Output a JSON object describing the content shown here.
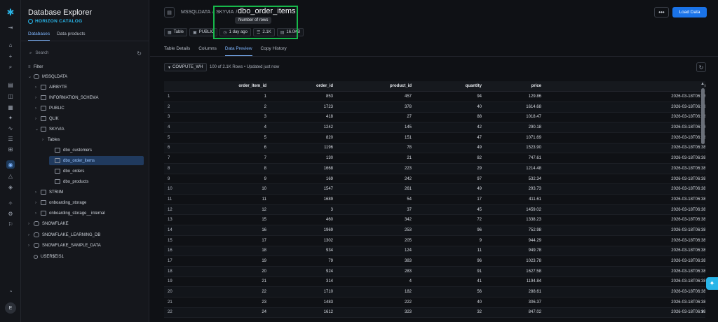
{
  "rail": {
    "icons": [
      "collapse-icon",
      "home-icon",
      "plus-icon",
      "search-icon",
      "worksheet-icon",
      "projects-icon",
      "dashboards-icon",
      "ai-ml-icon",
      "monitoring-icon",
      "marketplace-icon",
      "apps-icon",
      "data-icon",
      "governance-icon",
      "admin-icon",
      "settings-icon",
      "help-icon",
      "bell-icon"
    ],
    "avatar_initial": "E"
  },
  "explorer": {
    "title": "Database Explorer",
    "subtitle": "HORIZON CATALOG",
    "tabs": [
      "Databases",
      "Data products"
    ],
    "active_tab": "Databases",
    "search_placeholder": "Search",
    "tree": [
      {
        "label": "Filter",
        "kind": "filter"
      },
      {
        "label": "MSSQLDATA",
        "kind": "db",
        "open": true
      },
      {
        "label": "AIRBYTE",
        "kind": "schema"
      },
      {
        "label": "INFORMATION_SCHEMA",
        "kind": "schema"
      },
      {
        "label": "PUBLIC",
        "kind": "schema"
      },
      {
        "label": "QLIK",
        "kind": "schema"
      },
      {
        "label": "SKYVIA",
        "kind": "schema",
        "open": true
      },
      {
        "label": "Tables",
        "kind": "folder"
      },
      {
        "label": "dbo_customers",
        "kind": "table"
      },
      {
        "label": "dbo_order_items",
        "kind": "table",
        "selected": true
      },
      {
        "label": "dbo_orders",
        "kind": "table"
      },
      {
        "label": "dbo_products",
        "kind": "table"
      },
      {
        "label": "STRIIM",
        "kind": "schema"
      },
      {
        "label": "onboarding_storage",
        "kind": "schema"
      },
      {
        "label": "onboarding_storage__internal",
        "kind": "schema"
      },
      {
        "label": "SNOWFLAKE",
        "kind": "db"
      },
      {
        "label": "SNOWFLAKE_LEARNING_DB",
        "kind": "db"
      },
      {
        "label": "SNOWFLAKE_SAMPLE_DATA",
        "kind": "db"
      },
      {
        "label": "USER$EIS1",
        "kind": "user"
      }
    ]
  },
  "header": {
    "breadcrumb": [
      "MSSQLDATA",
      "/",
      "SKYVIA",
      "/"
    ],
    "object_name": "dbo_order_items",
    "tooltip": "Number of rows",
    "chips": [
      {
        "icon": "table-icon",
        "label": "Table"
      },
      {
        "icon": "schema-icon",
        "label": "PUBLIC"
      },
      {
        "icon": "clock-icon",
        "label": "1 day ago"
      },
      {
        "icon": "rows-icon",
        "label": "2.1K"
      },
      {
        "icon": "size-icon",
        "label": "16.0KB"
      }
    ],
    "more_label": "•••",
    "load_label": "Load Data"
  },
  "tabs": [
    "Table Details",
    "Columns",
    "Data Preview",
    "Copy History"
  ],
  "active_tab": "Data Preview",
  "warehouse": "COMPUTE_WH",
  "rows_info": "100 of 2.1K Rows • Updated just now",
  "table": {
    "columns": [
      "",
      "order_item_id",
      "order_id",
      "product_id",
      "quantity",
      "price",
      "modified"
    ],
    "rows": [
      [
        "1",
        "1",
        "853",
        "457",
        "94",
        "129.86",
        "2026-03-18T06:38:21.8033"
      ],
      [
        "2",
        "2",
        "1723",
        "378",
        "40",
        "1614.68",
        "2026-03-18T06:38:21.8033"
      ],
      [
        "3",
        "3",
        "418",
        "27",
        "88",
        "1018.47",
        "2026-03-18T06:38:21.8033"
      ],
      [
        "4",
        "4",
        "1242",
        "145",
        "42",
        "290.18",
        "2026-03-18T06:38:21.8033"
      ],
      [
        "5",
        "5",
        "820",
        "151",
        "47",
        "1071.69",
        "2026-03-18T06:38:21.8033"
      ],
      [
        "6",
        "6",
        "1196",
        "78",
        "49",
        "1523.90",
        "2026-03-18T06:38:21.8033"
      ],
      [
        "7",
        "7",
        "130",
        "21",
        "82",
        "747.61",
        "2026-03-18T06:38:21.8033"
      ],
      [
        "8",
        "8",
        "1668",
        "223",
        "29",
        "1214.48",
        "2026-03-18T06:38:21.8033"
      ],
      [
        "9",
        "9",
        "169",
        "242",
        "97",
        "532.34",
        "2026-03-18T06:38:21.8033"
      ],
      [
        "10",
        "10",
        "1547",
        "261",
        "49",
        "293.73",
        "2026-03-18T06:38:21.8033"
      ],
      [
        "11",
        "11",
        "1689",
        "54",
        "17",
        "411.61",
        "2026-03-18T06:38:21.8033"
      ],
      [
        "12",
        "12",
        "3",
        "37",
        "45",
        "1459.02",
        "2026-03-18T06:38:21.8033"
      ],
      [
        "13",
        "15",
        "460",
        "342",
        "72",
        "1338.23",
        "2026-03-18T06:38:21.8033"
      ],
      [
        "14",
        "16",
        "1969",
        "253",
        "96",
        "752.98",
        "2026-03-18T06:38:21.8033"
      ],
      [
        "15",
        "17",
        "1302",
        "205",
        "9",
        "944.29",
        "2026-03-18T06:38:21.8033"
      ],
      [
        "16",
        "18",
        "934",
        "124",
        "11",
        "949.78",
        "2026-03-18T06:38:21.8033"
      ],
      [
        "17",
        "19",
        "79",
        "383",
        "96",
        "1023.78",
        "2026-03-18T06:38:21.8033"
      ],
      [
        "18",
        "20",
        "924",
        "283",
        "91",
        "1627.58",
        "2026-03-18T06:38:21.8033"
      ],
      [
        "19",
        "21",
        "314",
        "4",
        "41",
        "1194.84",
        "2026-03-18T06:38:21.8033"
      ],
      [
        "20",
        "22",
        "1710",
        "182",
        "56",
        "288.61",
        "2026-03-18T06:38:21.8033"
      ],
      [
        "21",
        "23",
        "1483",
        "222",
        "40",
        "306.37",
        "2026-03-18T06:38:21.8033"
      ],
      [
        "22",
        "24",
        "1612",
        "323",
        "32",
        "847.02",
        "2026-03-18T06:38:21.8033"
      ]
    ]
  },
  "colors": {
    "accent": "#1a73e8",
    "brand": "#29b5e8",
    "highlight": "#17b84b"
  }
}
